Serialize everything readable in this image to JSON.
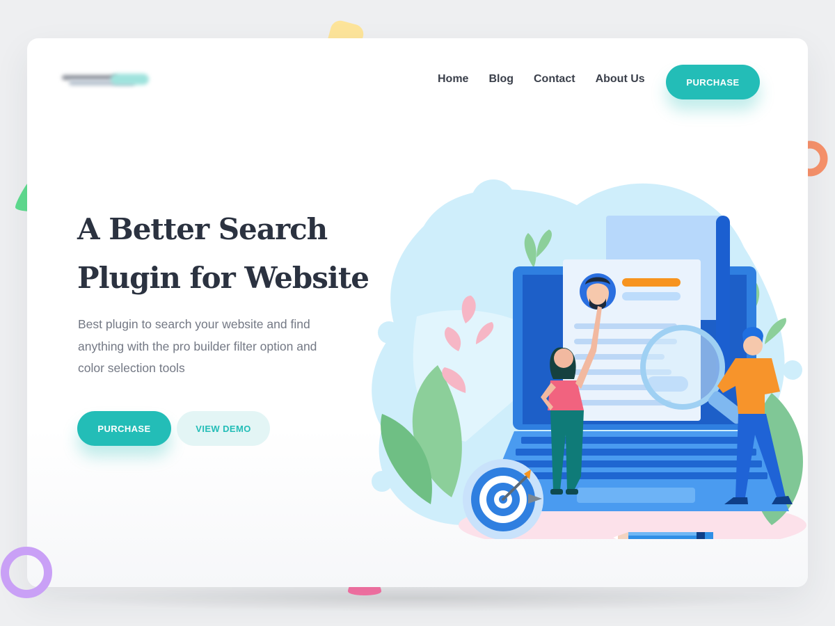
{
  "header": {
    "nav": [
      {
        "label": "Home"
      },
      {
        "label": "Blog"
      },
      {
        "label": "Contact"
      },
      {
        "label": "About Us"
      }
    ],
    "purchase_label": "PURCHASE"
  },
  "hero": {
    "title_line1": "A Better Search",
    "title_line2": "Plugin for Website",
    "subtitle_line1": "Best plugin to search your website and find",
    "subtitle_line2": "anything with the pro builder filter option and",
    "subtitle_line3": "color selection tools",
    "purchase_label": "PURCHASE",
    "demo_label": "VIEW DEMO"
  },
  "colors": {
    "accent": "#23bdb7",
    "accent_light": "#e3f5f5",
    "heading": "#2b3240",
    "body_text": "#737884",
    "laptop_blue": "#2f7fe0"
  },
  "icons": [
    "logo-blurred",
    "target-icon",
    "magnifier-icon",
    "pencil-icon",
    "avatar-icon"
  ]
}
